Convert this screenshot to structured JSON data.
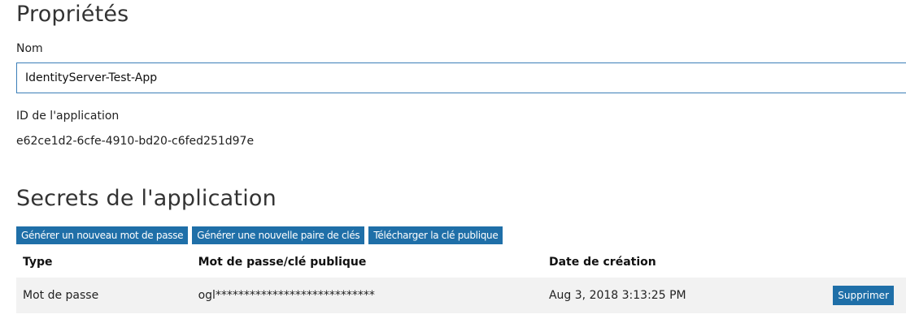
{
  "properties": {
    "title": "Propriétés",
    "name_label": "Nom",
    "name_value": "IdentityServer-Test-App",
    "app_id_label": "ID de l'application",
    "app_id_value": "e62ce1d2-6cfe-4910-bd20-c6fed251d97e"
  },
  "secrets": {
    "title": "Secrets de l'application",
    "buttons": {
      "generate_password": "Générer un nouveau mot de passe",
      "generate_keypair": "Générer une nouvelle paire de clés",
      "download_public_key": "Télécharger la clé publique"
    },
    "table": {
      "columns": [
        "Type",
        "Mot de passe/clé publique",
        "Date de création",
        ""
      ],
      "rows": [
        {
          "type": "Mot de passe",
          "secret": "ogl****************************",
          "created": "Aug 3, 2018 3:13:25 PM",
          "action": "Supprimer"
        }
      ]
    }
  },
  "colors": {
    "accent": "#1f6fa8",
    "input_border": "#3c7fb8",
    "row_background": "#f2f2f2"
  }
}
